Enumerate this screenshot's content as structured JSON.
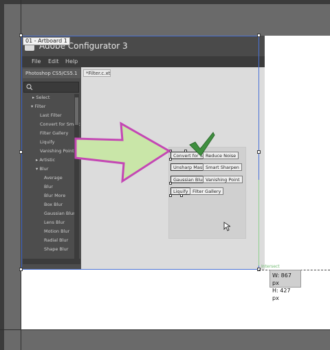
{
  "artboard": {
    "label": "01 - Artboard 1"
  },
  "app": {
    "title": "Adobe Configurator 3",
    "menu": [
      "File",
      "Edit",
      "Help"
    ],
    "tab_label": "*Filter.c.xt",
    "panel_title": "Photoshop CS5/CS5.1"
  },
  "tree": [
    "Select",
    "Filter",
    "Last Filter",
    "Convert for Smart",
    "Filter Gallery",
    "Liquify",
    "Vanishing Point",
    "Artistic",
    "Blur",
    "Average",
    "Blur",
    "Blur More",
    "Box Blur",
    "Gaussian Blur",
    "Lens Blur",
    "Motion Blur",
    "Radial Blur",
    "Shape Blur"
  ],
  "canvas_buttons": [
    "Convert for S",
    "Reduce Noise",
    "Unsharp Mask",
    "Smart Sharpen",
    "Gaussian Blur",
    "Vanishing Point",
    "Liquify",
    "Filter Gallery"
  ],
  "intersect_label": "Intersect",
  "dimensions": {
    "width": "W: 867 px",
    "height": "H: 427 px"
  },
  "colors": {
    "selection": "#4a72d6",
    "arrow_fill": "#c9e6a8",
    "arrow_outline": "#c447b4",
    "checkmark": "#3f8f3f"
  }
}
